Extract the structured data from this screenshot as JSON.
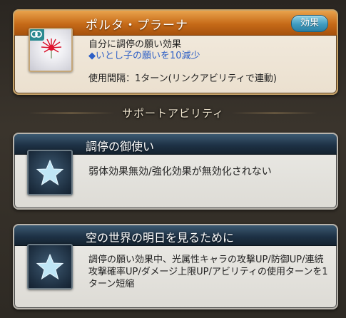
{
  "ability": {
    "name": "ポルタ・プラーナ",
    "effect_button": "効果",
    "description": "自分に調停の願い効果",
    "sub_effect": "◆いとし子の願いを10減少",
    "cooldown": "使用間隔：1ターン(リンクアビリティで連動)"
  },
  "section_title": "サポートアビリティ",
  "support_abilities": [
    {
      "name": "調停の御使い",
      "description": "弱体効果無効/強化効果が無効化されない"
    },
    {
      "name": "空の世界の明日を見るために",
      "description": "調停の願い効果中、光属性キャラの攻撃UP/防御UP/連続攻撃確率UP/ダメージ上限UP/アビリティの使用ターンを1ターン短縮"
    }
  ],
  "colors": {
    "ability_header": "#c66a18",
    "support_header": "#1e3246",
    "sub_effect_text": "#2d5fc6",
    "effect_button": "#3f9cc0"
  },
  "icons": {
    "ability_icon": "red-flower-icon",
    "link_icon": "link-icon",
    "support_icon": "star-icon"
  }
}
